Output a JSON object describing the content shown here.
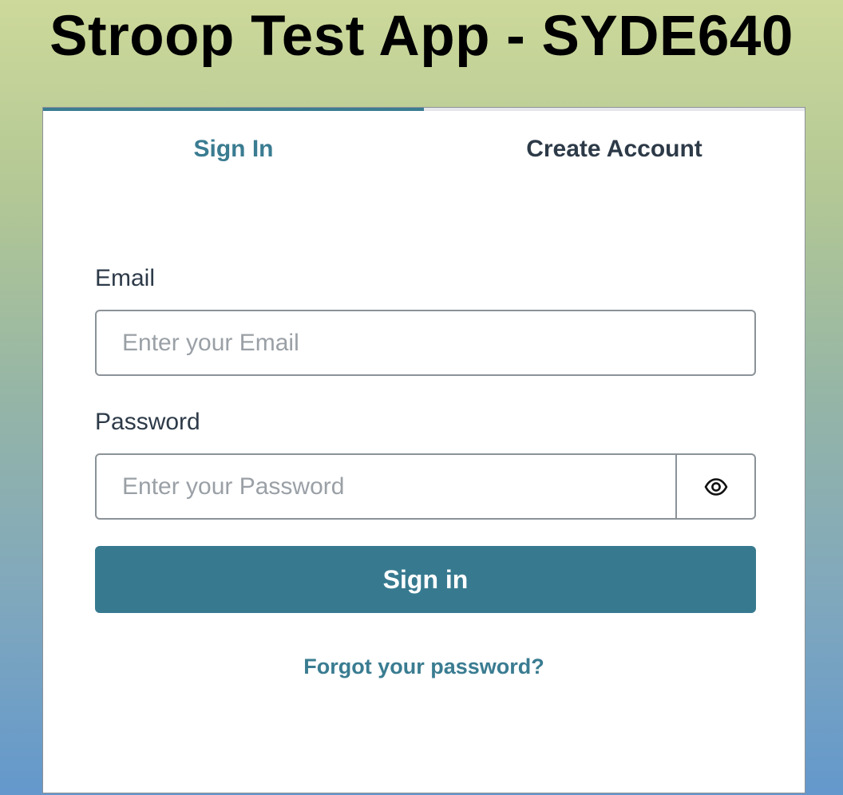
{
  "app": {
    "title": "Stroop Test App - SYDE640"
  },
  "auth_card": {
    "tabs": [
      {
        "label": "Sign In",
        "active": true
      },
      {
        "label": "Create Account",
        "active": false
      }
    ],
    "email": {
      "label": "Email",
      "placeholder": "Enter your Email",
      "value": ""
    },
    "password": {
      "label": "Password",
      "placeholder": "Enter your Password",
      "value": "",
      "toggle_icon": "eye-icon"
    },
    "submit_label": "Sign in",
    "forgot_link": "Forgot your password?"
  },
  "colors": {
    "accent": "#377a90",
    "text_dark": "#2d3a48",
    "border": "#8b9298"
  }
}
